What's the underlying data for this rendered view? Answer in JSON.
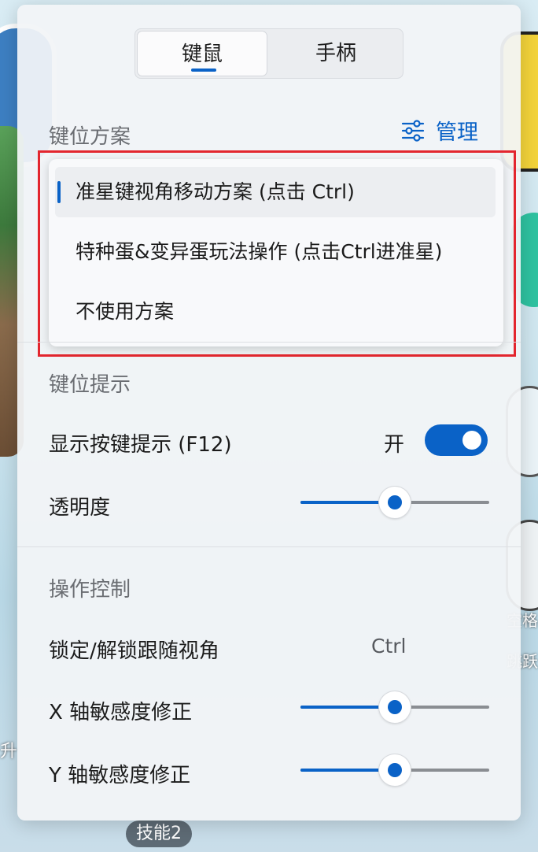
{
  "background": {
    "label_left": "升",
    "label_right_1": "空格",
    "label_right_2": "跳跃",
    "skill_pill": "技能2"
  },
  "tabs": [
    {
      "label": "键鼠",
      "active": true
    },
    {
      "label": "手柄",
      "active": false
    }
  ],
  "key_scheme": {
    "title": "键位方案",
    "manage_label": "管理",
    "manage_icon": "sliders-icon",
    "options": [
      {
        "label": "准星键视角移动方案 (点击 Ctrl)",
        "selected": true
      },
      {
        "label": "特种蛋&变异蛋玩法操作 (点击Ctrl进准星)",
        "selected": false
      },
      {
        "label": "不使用方案",
        "selected": false
      }
    ]
  },
  "key_hint": {
    "title": "键位提示",
    "show_hint_label": "显示按键提示 (F12)",
    "toggle_state_label": "开",
    "toggle_on": true,
    "opacity_label": "透明度",
    "opacity_value": 0.5
  },
  "controls": {
    "title": "操作控制",
    "lock_label": "锁定/解锁跟随视角",
    "lock_shortcut": "Ctrl",
    "x_sens_label": "X 轴敏感度修正",
    "x_sens_value": 0.5,
    "y_sens_label": "Y 轴敏感度修正",
    "y_sens_value": 0.5
  },
  "colors": {
    "accent": "#0a62c7",
    "highlight_box": "#e3262e"
  }
}
